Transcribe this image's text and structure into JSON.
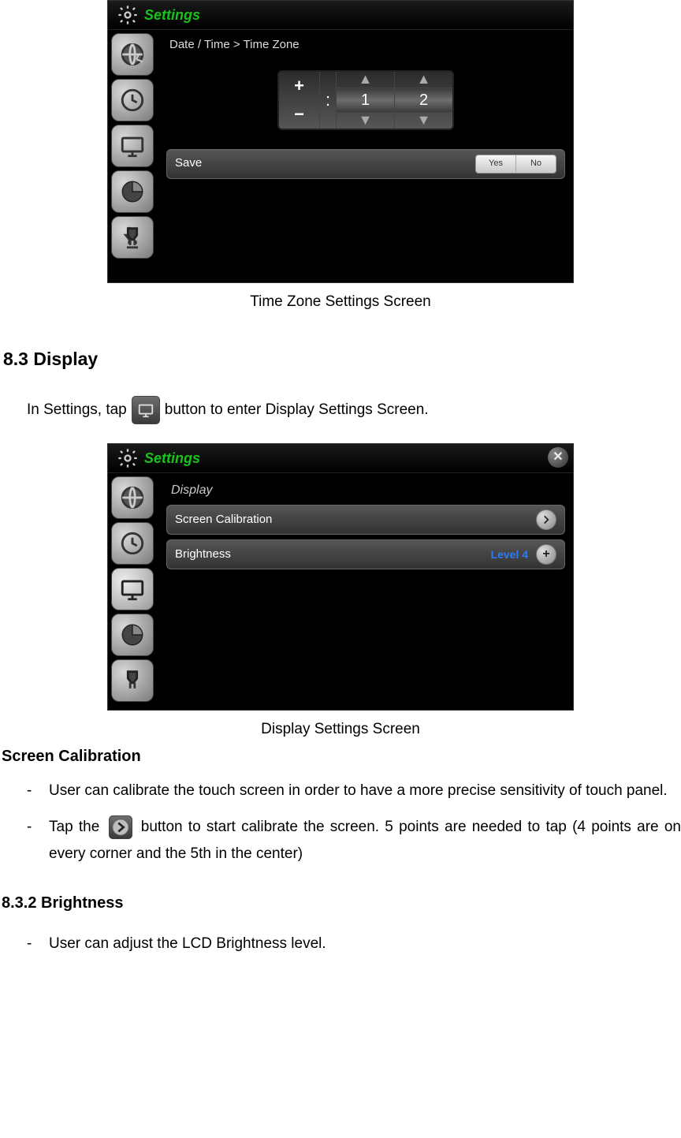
{
  "settings_title": "Settings",
  "timezone_screen": {
    "breadcrumb": "Date / Time > Time Zone",
    "sign_plus": "+",
    "sign_minus": "−",
    "separator": ":",
    "digit1": "1",
    "digit2": "2",
    "save_label": "Save",
    "yes_label": "Yes",
    "no_label": "No",
    "caption": "Time Zone Settings Screen"
  },
  "section_display": {
    "heading": "8.3 Display",
    "intro_pre": "In Settings, tap",
    "intro_post": "button to enter Display Settings Screen."
  },
  "display_screen": {
    "panel_title": "Display",
    "row_calibration": "Screen Calibration",
    "row_brightness": "Brightness",
    "brightness_value": "Level 4",
    "caption": "Display Settings Screen"
  },
  "screen_calibration": {
    "heading": "Screen Calibration",
    "bullet1": "User can calibrate the touch screen in order to have a more precise sensitivity of touch panel.",
    "bullet2_pre": "Tap the",
    "bullet2_post": "button to start calibrate the screen. 5 points are needed to tap (4 points are on every corner and the 5th in the center)"
  },
  "brightness_section": {
    "heading": "8.3.2 Brightness",
    "bullet1": "User can adjust the LCD Brightness level."
  }
}
